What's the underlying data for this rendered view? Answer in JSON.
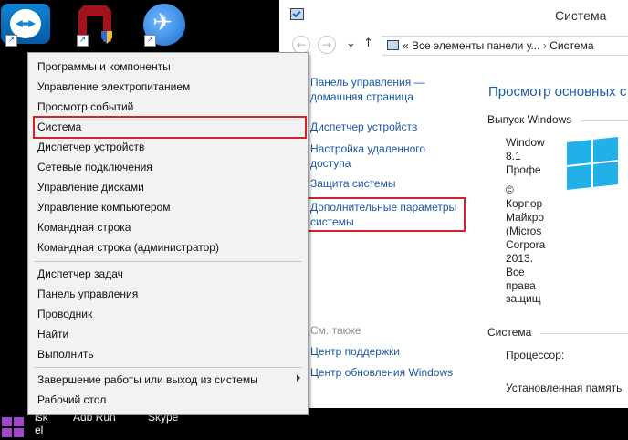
{
  "desktop": {
    "icons": [
      {
        "label": "",
        "icon": "teamviewer-icon"
      },
      {
        "label": "Adb Run",
        "icon": "adb-run-icon"
      },
      {
        "label": "Skype",
        "icon": "skype-icon"
      }
    ],
    "partial_labels": {
      "left_isk": "isk",
      "left_el": "el"
    }
  },
  "window": {
    "title": "Система",
    "breadcrumb": [
      "Все элементы панели у...",
      "Система"
    ],
    "breadcrumb_sep": "«",
    "breadcrumb_arrow": "›",
    "nav": {
      "back": "←",
      "forward": "→",
      "up": "↑"
    },
    "sidebar": {
      "home_link": "Панель управления — домашняя страница",
      "links": [
        "Диспетчер устройств",
        "Настройка удаленного доступа",
        "Защита системы",
        "Дополнительные параметры системы"
      ],
      "see_also": "См. также",
      "see_also_links": [
        "Центр поддержки",
        "Центр обновления Windows"
      ]
    },
    "main": {
      "heading": "Просмотр основных с",
      "edition_label": "Выпуск Windows",
      "edition_lines": [
        "Window",
        "8.1",
        "Профе"
      ],
      "copyright_lines": [
        "©",
        "Корпор",
        "Майкро",
        "(Micros",
        "Corpora",
        "2013.",
        "Все",
        "права",
        "защищ"
      ],
      "system_label": "Система",
      "processor_label": "Процессор:",
      "ram_label": "Установленная память"
    }
  },
  "context_menu": {
    "group1": [
      "Программы и компоненты",
      "Управление электропитанием",
      "Просмотр событий",
      "Система",
      "Диспетчер устройств",
      "Сетевые подключения",
      "Управление дисками",
      "Управление компьютером",
      "Командная строка",
      "Командная строка (администратор)"
    ],
    "group2": [
      "Диспетчер задач",
      "Панель управления",
      "Проводник",
      "Найти",
      "Выполнить"
    ],
    "group3": [
      "Завершение работы или выход из системы",
      "Рабочий стол"
    ]
  },
  "colors": {
    "highlight": "#d2232a",
    "link": "#1a56a8",
    "heading": "#1a5fa5",
    "start": "#a147c9",
    "win_logo": "#22b0e8"
  }
}
